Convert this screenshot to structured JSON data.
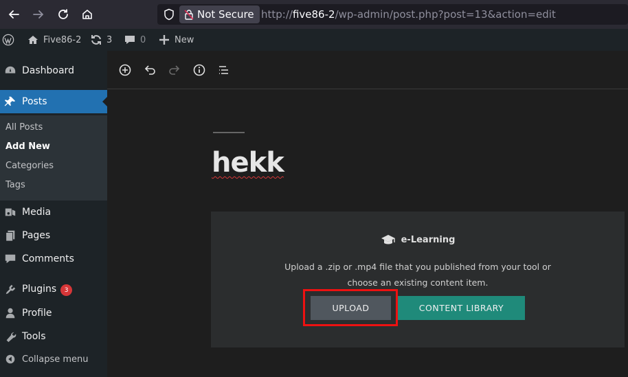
{
  "browser": {
    "security_label": "Not Secure",
    "url_prefix": "http://",
    "url_host": "five86-2",
    "url_path": "/wp-admin/post.php?post=13&action=edit"
  },
  "adminbar": {
    "site_name": "Five86-2",
    "updates_count": "3",
    "comments_count": "0",
    "new_label": "New"
  },
  "sidebar": {
    "dashboard": "Dashboard",
    "posts": "Posts",
    "submenu": [
      "All Posts",
      "Add New",
      "Categories",
      "Tags"
    ],
    "media": "Media",
    "pages": "Pages",
    "comments": "Comments",
    "plugins": "Plugins",
    "plugins_badge": "3",
    "profile": "Profile",
    "tools": "Tools",
    "collapse": "Collapse menu"
  },
  "editor": {
    "post_title": "hekk",
    "block_title": "e-Learning",
    "block_description": "Upload a .zip or .mp4 file that you published from your tool or choose an existing content item.",
    "upload_label": "UPLOAD",
    "library_label": "CONTENT LIBRARY"
  },
  "colors": {
    "accent": "#2271b1",
    "library_button": "#1f8a7a",
    "highlight": "#ee1111"
  }
}
